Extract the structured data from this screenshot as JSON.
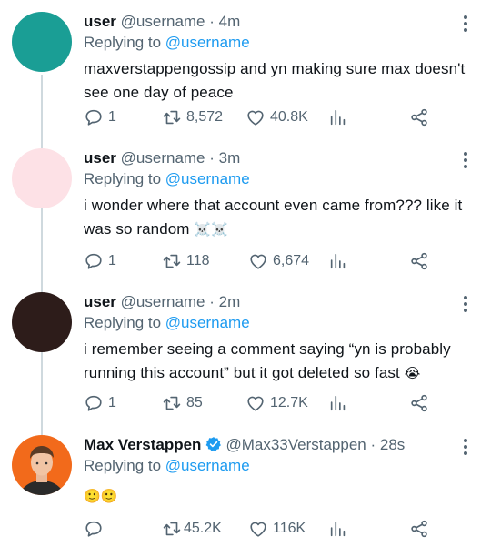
{
  "tweets": [
    {
      "name": "user",
      "handle": "@username",
      "time": "· 4m",
      "replying_prefix": "Replying to",
      "replying_to": "@username",
      "text": "maxverstappengossip and yn making sure max doesn't see one day of peace",
      "emoji": "",
      "avatar_color": "#1a9e95",
      "replies": "1",
      "retweets": "8,572",
      "likes": "40.8K"
    },
    {
      "name": "user",
      "handle": "@username",
      "time": "· 3m",
      "replying_prefix": "Replying to",
      "replying_to": "@username",
      "text": "i wonder where that account even came from??? like it was so random",
      "emoji": "☠️☠️",
      "avatar_color": "#fde1e6",
      "replies": "1",
      "retweets": "118",
      "likes": "6,674"
    },
    {
      "name": "user",
      "handle": "@username",
      "time": "· 2m",
      "replying_prefix": "Replying to",
      "replying_to": "@username",
      "text": "i remember seeing a comment saying “yn is probably running this account” but it got deleted so fast",
      "emoji": "😭",
      "avatar_color": "#2d1c1a",
      "replies": "1",
      "retweets": "85",
      "likes": "12.7K"
    },
    {
      "name": "Max Verstappen",
      "handle": "@Max33Verstappen",
      "time": "· 28s",
      "replying_prefix": "Replying to",
      "replying_to": "@username",
      "text": "",
      "emoji": "🙂🙂",
      "avatar_color": "#f26a1b",
      "replies": "",
      "retweets": "45.2K",
      "likes": "116K"
    }
  ],
  "colors": {
    "link": "#1d9bf0",
    "secondary_text": "#536471",
    "verified_badge": "#1d9bf0",
    "thread_line": "#cfd9de"
  },
  "icons": {
    "reply": "speech-bubble-icon",
    "retweet": "retweet-arrows-icon",
    "like": "heart-icon",
    "analytics": "bar-chart-icon",
    "share": "share-nodes-icon",
    "more": "vertical-dots-icon",
    "verified": "verified-badge-icon"
  }
}
